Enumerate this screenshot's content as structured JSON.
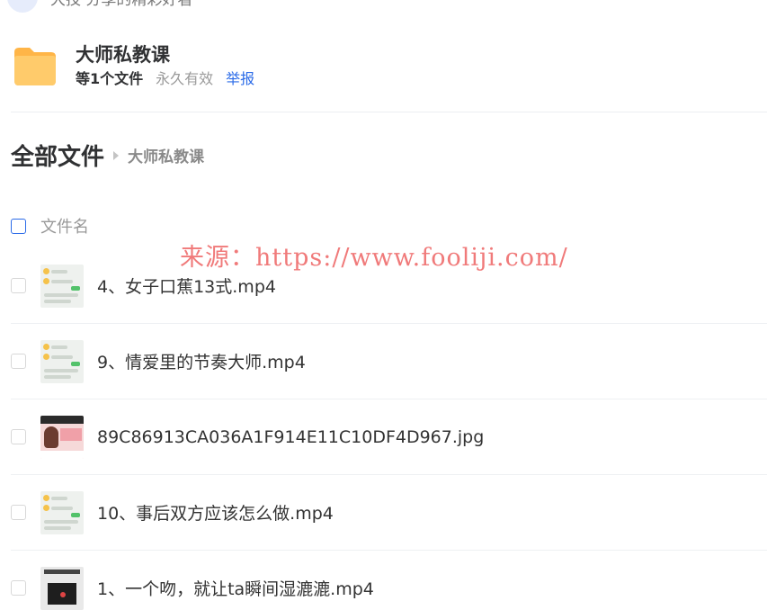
{
  "top": {
    "text": "大技 分享的精彩好看"
  },
  "share": {
    "title": "大师私教课",
    "count": "等1个文件",
    "validity": "永久有效",
    "report": "举报"
  },
  "breadcrumb": {
    "root": "全部文件",
    "current": "大师私教课"
  },
  "list": {
    "column_name": "文件名",
    "files": [
      {
        "name": "4、女子口蕉13式.mp4",
        "thumb": "chat"
      },
      {
        "name": "9、情爱里的节奏大师.mp4",
        "thumb": "chat"
      },
      {
        "name": "89C86913CA036A1F914E11C10DF4D967.jpg",
        "thumb": "photo"
      },
      {
        "name": "10、事后双方应该怎么做.mp4",
        "thumb": "chat"
      },
      {
        "name": "1、一个吻，就让ta瞬间湿漉漉.mp4",
        "thumb": "dark"
      }
    ]
  },
  "watermark": "来源：https://www.fooliji.com/",
  "colors": {
    "link": "#2b6be8",
    "watermark": "#f07a7a",
    "folder": "#ffc35c"
  }
}
